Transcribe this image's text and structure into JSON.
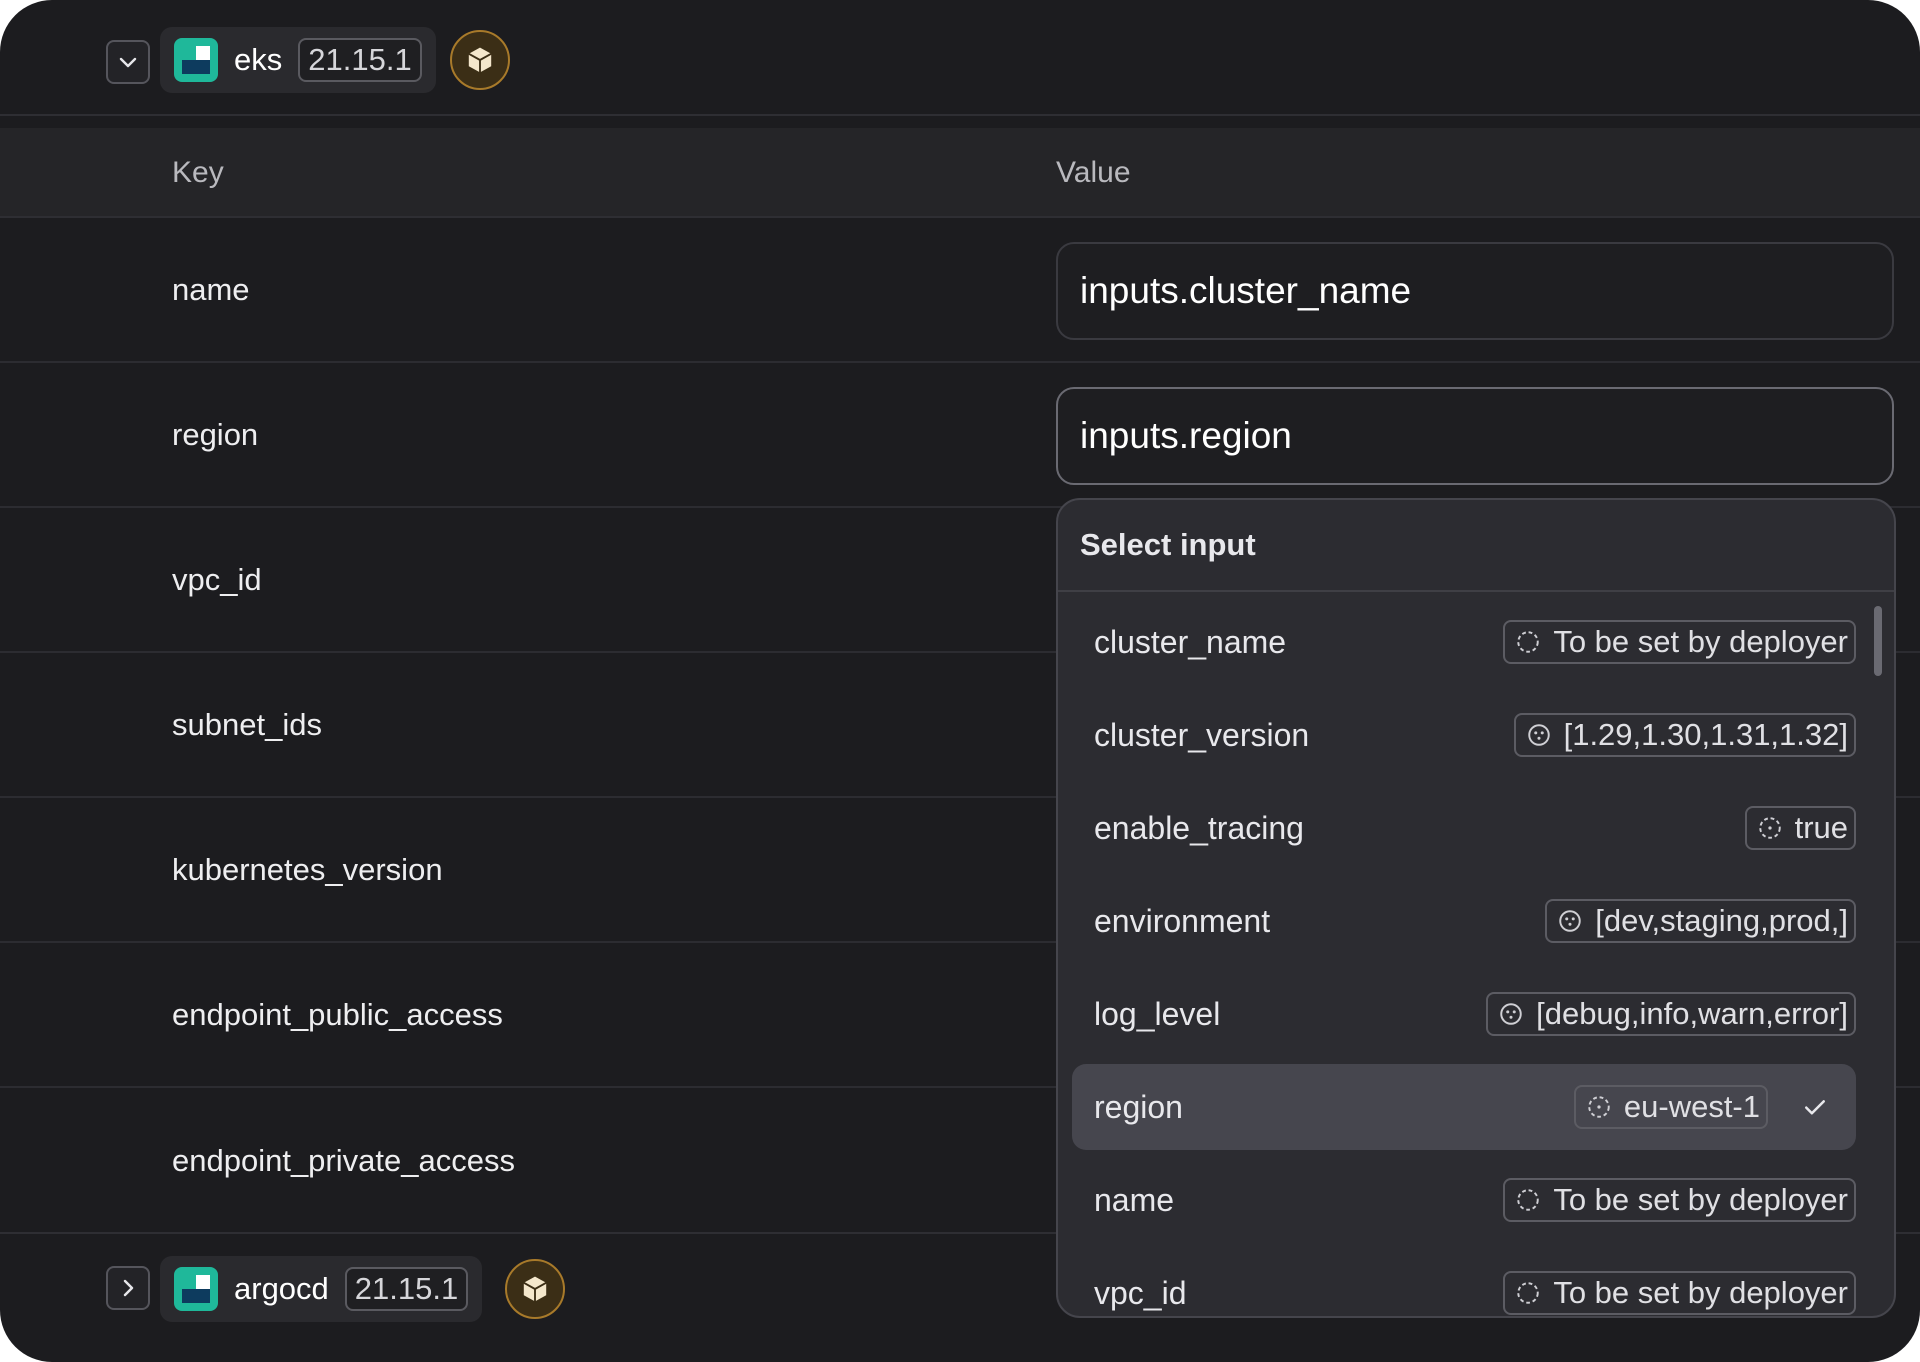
{
  "modules": [
    {
      "name": "eks",
      "version": "21.15.1",
      "expanded": true
    },
    {
      "name": "argocd",
      "version": "21.15.1",
      "expanded": false
    }
  ],
  "table": {
    "key_header": "Key",
    "value_header": "Value",
    "rows": [
      {
        "key": "name",
        "value": "inputs.cluster_name"
      },
      {
        "key": "region",
        "value": "inputs.region"
      },
      {
        "key": "vpc_id"
      },
      {
        "key": "subnet_ids"
      },
      {
        "key": "kubernetes_version"
      },
      {
        "key": "endpoint_public_access"
      },
      {
        "key": "endpoint_private_access"
      }
    ]
  },
  "dropdown": {
    "title": "Select input",
    "options": [
      {
        "name": "cluster_name",
        "badge": "To be set by deployer",
        "icon": "dashed-circle-icon"
      },
      {
        "name": "cluster_version",
        "badge": "[1.29,1.30,1.31,1.32]",
        "icon": "options-circle-icon"
      },
      {
        "name": "enable_tracing",
        "badge": "true",
        "icon": "dotted-circle-icon"
      },
      {
        "name": "environment",
        "badge": "[dev,staging,prod,]",
        "icon": "options-circle-icon"
      },
      {
        "name": "log_level",
        "badge": "[debug,info,warn,error]",
        "icon": "options-circle-icon"
      },
      {
        "name": "region",
        "badge": "eu-west-1",
        "icon": "dotted-circle-icon",
        "selected": true
      },
      {
        "name": "name",
        "badge": "To be set by deployer",
        "icon": "dashed-circle-icon"
      },
      {
        "name": "vpc_id",
        "badge": "To be set by deployer",
        "icon": "dashed-circle-icon"
      }
    ]
  },
  "colors": {
    "background": "#1c1c1f",
    "accent_logo": "#1fb89a",
    "package_icon": "#a87a2a"
  }
}
